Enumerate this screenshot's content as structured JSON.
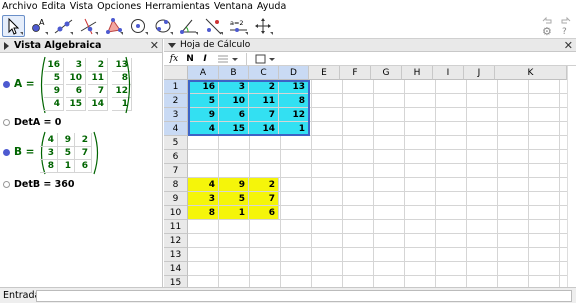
{
  "menu": [
    "Archivo",
    "Edita",
    "Vista",
    "Opciones",
    "Herramientas",
    "Ventana",
    "Ayuda"
  ],
  "toolbar": {
    "tools": [
      "move-tool",
      "point-tool",
      "line-tool",
      "perpendicular-tool",
      "polygon-tool",
      "circle-tool",
      "conic-tool",
      "angle-tool",
      "reflect-tool",
      "slider-tool",
      "move-view-tool"
    ],
    "slider_label": "a=2"
  },
  "algebra": {
    "title": "Vista Algebraica",
    "A": {
      "name": "A =",
      "rows": [
        [
          "16",
          "3",
          "2",
          "13"
        ],
        [
          "5",
          "10",
          "11",
          "8"
        ],
        [
          "9",
          "6",
          "7",
          "12"
        ],
        [
          "4",
          "15",
          "14",
          "1"
        ]
      ]
    },
    "detA": "DetA = 0",
    "B": {
      "name": "B =",
      "rows": [
        [
          "4",
          "9",
          "2"
        ],
        [
          "3",
          "5",
          "7"
        ],
        [
          "8",
          "1",
          "6"
        ]
      ]
    },
    "detB": "DetB = 360"
  },
  "sheet": {
    "title": "Hoja de Cálculo",
    "fx": "fx",
    "bold": "N",
    "italic": "I",
    "columns": [
      "A",
      "B",
      "C",
      "D",
      "E",
      "F",
      "G",
      "H",
      "I",
      "J",
      "K"
    ],
    "rows": [
      "1",
      "2",
      "3",
      "4",
      "5",
      "6",
      "7",
      "8",
      "9",
      "10",
      "11",
      "12",
      "13",
      "14",
      "15"
    ],
    "cells_cyan": [
      [
        "16",
        "3",
        "2",
        "13"
      ],
      [
        "5",
        "10",
        "11",
        "8"
      ],
      [
        "9",
        "6",
        "7",
        "12"
      ],
      [
        "4",
        "15",
        "14",
        "1"
      ]
    ],
    "cells_yellow": [
      [
        "4",
        "9",
        "2"
      ],
      [
        "3",
        "5",
        "7"
      ],
      [
        "8",
        "1",
        "6"
      ]
    ]
  },
  "input": {
    "label": "Entrada:",
    "value": ""
  },
  "colors": {
    "cyan": "#33e0f2",
    "yellow": "#f5f50a",
    "matrix_text": "#006400",
    "bullet": "#4d5ad0"
  }
}
